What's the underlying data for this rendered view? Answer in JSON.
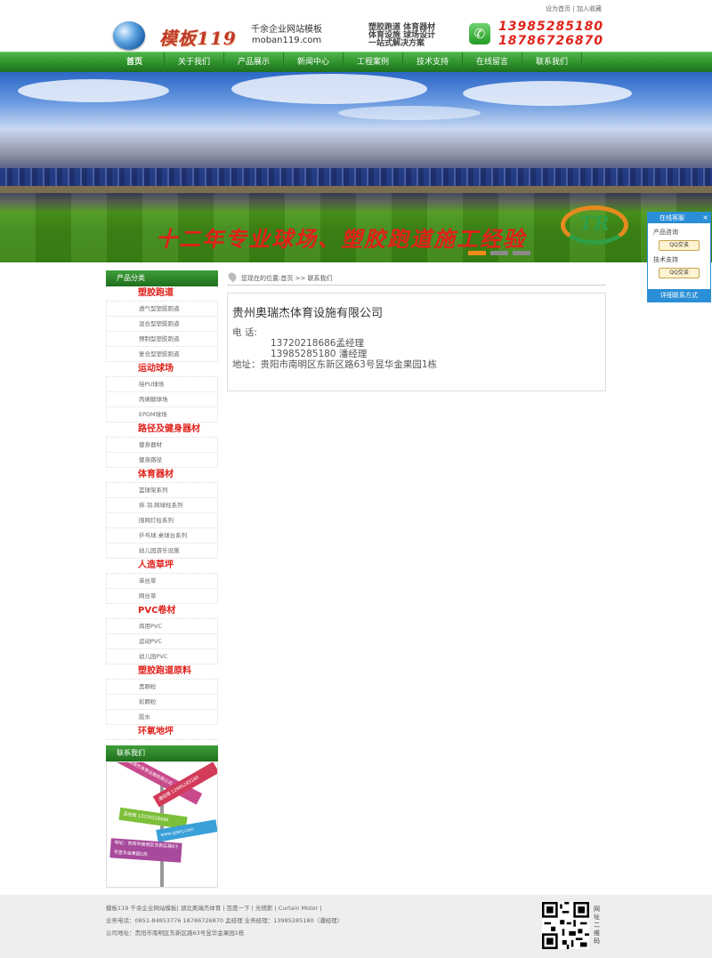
{
  "top": {
    "links": [
      "设为首页",
      "加入收藏"
    ],
    "sep": "|"
  },
  "header": {
    "logo_text": "模板119",
    "tagline_1": "千余企业网站模板",
    "tagline_2": "moban119.com",
    "slogan_1": "塑胶跑道 体育器材",
    "slogan_2": "体育设施 球场设计",
    "slogan_3": "一站式解决方案",
    "phone_1": "13985285180",
    "phone_2": "18786726870"
  },
  "nav": {
    "items": [
      "首页",
      "关于我们",
      "产品展示",
      "新闻中心",
      "工程案例",
      "技术支持",
      "在线留言",
      "联系我们"
    ]
  },
  "banner": {
    "text": "十二年专业球场、塑胶跑道施工经验",
    "logo_text": "TR"
  },
  "sidebar": {
    "title": "产品分类",
    "categories": [
      {
        "name": "塑胶跑道",
        "items": [
          "透气型塑胶跑道",
          "混合型塑胶跑道",
          "预制型塑胶跑道",
          "复合型塑胶跑道"
        ]
      },
      {
        "name": "运动球场",
        "items": [
          "硅PU球场",
          "丙烯酸球场",
          "EPDM球场"
        ]
      },
      {
        "name": "路径及健身器材",
        "items": [
          "健身器材",
          "健身路径"
        ]
      },
      {
        "name": "体育器材",
        "items": [
          "篮球架系列",
          "排.羽.网球柱系列",
          "围网灯柱系列",
          "乒乓球.桌球台系列",
          "幼儿园游乐设施"
        ]
      },
      {
        "name": "人造草坪",
        "items": [
          "单丝草",
          "网丝草"
        ]
      },
      {
        "name": "PVC卷材",
        "items": [
          "商用PVC",
          "运动PVC",
          "幼儿园PVC"
        ]
      },
      {
        "name": "塑胶跑道原料",
        "items": [
          "黑颗粒",
          "彩颗粒",
          "胶水"
        ]
      },
      {
        "name": "环氧地坪",
        "items": []
      }
    ],
    "contact_title": "联系我们",
    "signs": [
      "贵州奥瑞杰体育设施有限公司",
      "潘经理 13985285180",
      "孟经理 13720218686",
      "www.gzarj.com",
      "地址：贵阳市南明区东新区路63号昱华金果园1栋"
    ]
  },
  "breadcrumb": {
    "prefix": "您现在的位置:",
    "home": "首页",
    "sep": ">>",
    "current": "联系我们"
  },
  "contact": {
    "company": "贵州奥瑞杰体育设施有限公司",
    "phone_label": "电  话:",
    "phone_1": "13720218686孟经理",
    "phone_2": "13985285180 潘经理",
    "address": "地址：贵阳市南明区东新区路63号昱华金果园1栋"
  },
  "float_panel": {
    "title": "在线客服",
    "close": "×",
    "label_1": "产品咨询",
    "label_2": "技术支持",
    "qq_label": "QQ交谈",
    "footer": "详细联系方式"
  },
  "footer": {
    "line_1": "模板119 千余企业网站模板| 湖北奥瑞杰体育 | 百度一下 | 光德斯 | Curtain Motor |",
    "line_2": "业务电话：0851-84853776 18786726870 孟经理   业务经理：13985285180（潘经理）",
    "line_3": "公司地址：贵阳市南明区东新区路63号昱华金果园1栋",
    "qr_label": "网址二维码"
  },
  "colors": {
    "nav_green": "#2c8f2a",
    "accent_red": "#e0201a",
    "float_blue": "#2a8fd6"
  }
}
